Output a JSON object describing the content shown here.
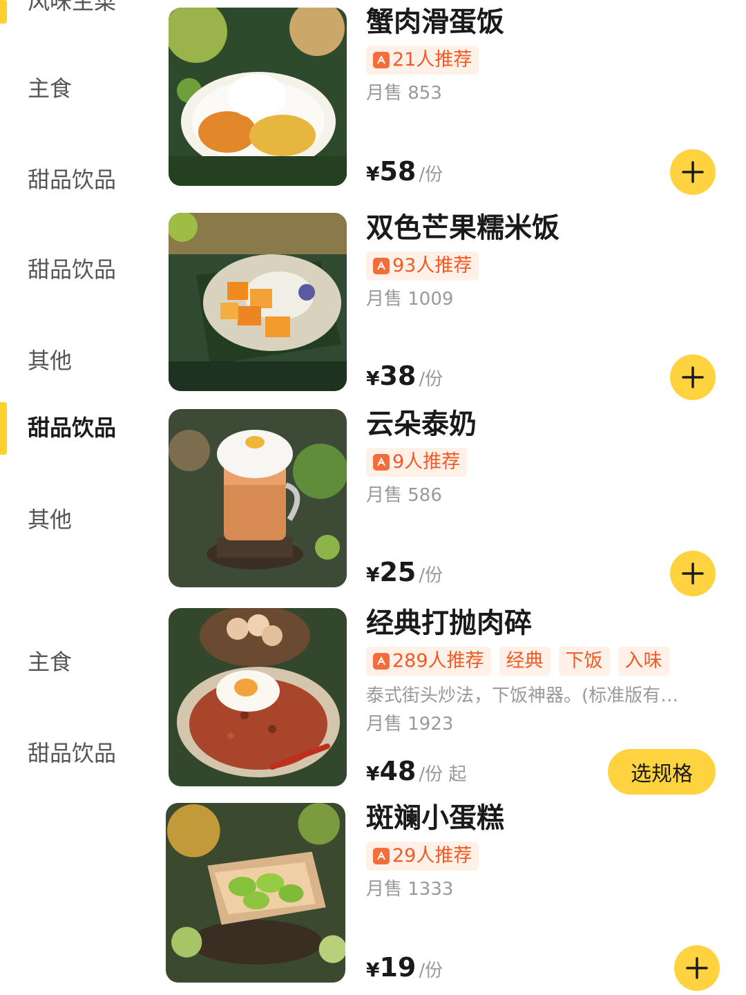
{
  "sidebar": {
    "categories": [
      {
        "label": "风味主菜",
        "active": false
      },
      {
        "label": "主食",
        "active": false
      },
      {
        "label": "甜品饮品",
        "active": false
      },
      {
        "label": "甜品饮品",
        "active": false
      },
      {
        "label": "其他",
        "active": false
      },
      {
        "label": "甜品饮品",
        "active": true
      },
      {
        "label": "其他",
        "active": false
      },
      {
        "label": "主食",
        "active": false
      },
      {
        "label": "甜品饮品",
        "active": false
      }
    ]
  },
  "colors": {
    "accent": "#FFD23F",
    "tag_text": "#F15A24",
    "tag_bg": "#FFF1E8",
    "muted": "#999999"
  },
  "items": [
    {
      "name": "蟹肉滑蛋饭",
      "recommend": "21人推荐",
      "sales": "月售 853",
      "price_symbol": "¥",
      "price": "58",
      "unit": "/份",
      "action_icon": "plus-icon"
    },
    {
      "name": "双色芒果糯米饭",
      "recommend": "93人推荐",
      "sales": "月售 1009",
      "price_symbol": "¥",
      "price": "38",
      "unit": "/份",
      "action_icon": "plus-icon"
    },
    {
      "name": "云朵泰奶",
      "recommend": "9人推荐",
      "sales": "月售 586",
      "price_symbol": "¥",
      "price": "25",
      "unit": "/份",
      "action_icon": "plus-icon"
    },
    {
      "name": "经典打抛肉碎",
      "recommend": "289人推荐",
      "tags": [
        "经典",
        "下饭",
        "入味"
      ],
      "description": "泰式街头炒法，下饭神器。(标准版有…",
      "sales": "月售 1923",
      "price_symbol": "¥",
      "price": "48",
      "unit": "/份 起",
      "action_label": "选规格"
    },
    {
      "name": "斑斓小蛋糕",
      "recommend": "29人推荐",
      "sales": "月售 1333",
      "price_symbol": "¥",
      "price": "19",
      "unit": "/份",
      "action_icon": "plus-icon"
    }
  ]
}
